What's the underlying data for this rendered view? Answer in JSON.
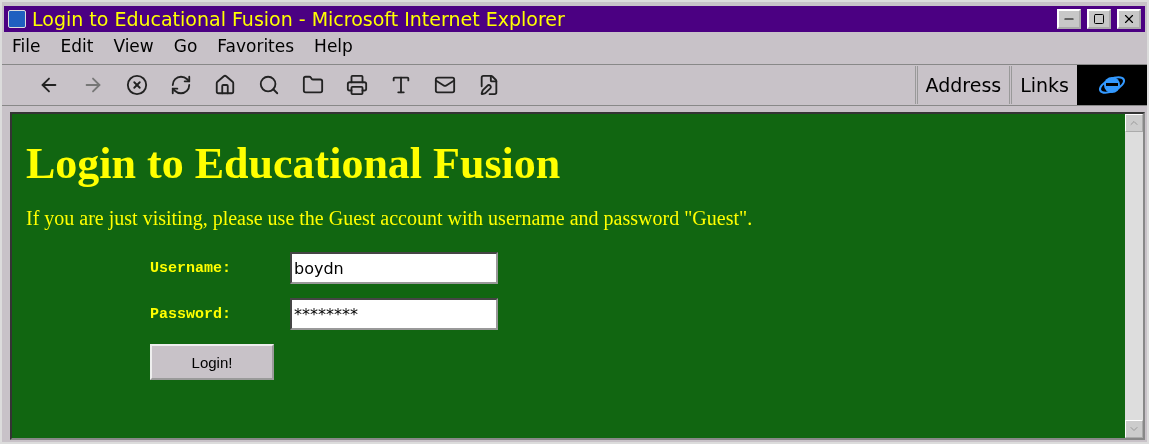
{
  "window": {
    "title": "Login to Educational Fusion - Microsoft Internet Explorer"
  },
  "menu": [
    "File",
    "Edit",
    "View",
    "Go",
    "Favorites",
    "Help"
  ],
  "toolbar": {
    "address_label": "Address",
    "links_label": "Links"
  },
  "page": {
    "heading": "Login to Educational Fusion",
    "intro": "If you are just visiting, please use the Guest account with username and password \"Guest\".",
    "fields": [
      {
        "label": "Username:",
        "value": "boydn"
      },
      {
        "label": "Password:",
        "value": "********"
      }
    ],
    "button": "Login!"
  }
}
